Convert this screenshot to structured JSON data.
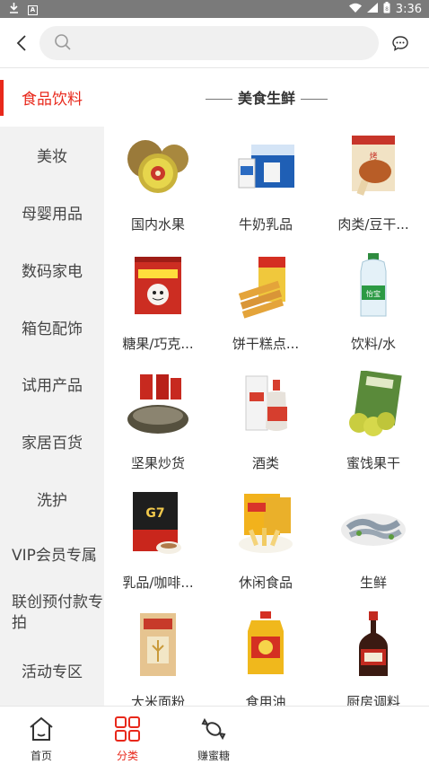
{
  "status_bar": {
    "time": "3:36"
  },
  "header": {
    "search_placeholder": ""
  },
  "sidebar": {
    "items": [
      {
        "label": "食品饮料",
        "active": true
      },
      {
        "label": "美妆"
      },
      {
        "label": "母婴用品"
      },
      {
        "label": "数码家电"
      },
      {
        "label": "箱包配饰"
      },
      {
        "label": "试用产品"
      },
      {
        "label": "家居百货"
      },
      {
        "label": "洗护"
      },
      {
        "label": "VIP会员专属"
      },
      {
        "label": "联创预付款专拍"
      },
      {
        "label": "活动专区"
      }
    ]
  },
  "section": {
    "title": "美食生鲜"
  },
  "categories": [
    {
      "label": "国内水果",
      "icon": "kiwi-fruit-icon"
    },
    {
      "label": "牛奶乳品",
      "icon": "milk-box-icon"
    },
    {
      "label": "肉类/豆干...",
      "icon": "meat-snack-icon"
    },
    {
      "label": "糖果/巧克...",
      "icon": "candy-bag-icon"
    },
    {
      "label": "饼干糕点...",
      "icon": "wafer-biscuit-icon"
    },
    {
      "label": "饮料/水",
      "icon": "water-bottle-icon"
    },
    {
      "label": "坚果炒货",
      "icon": "sunflower-seeds-icon"
    },
    {
      "label": "酒类",
      "icon": "liquor-bottle-icon"
    },
    {
      "label": "蜜饯果干",
      "icon": "dried-fruit-bag-icon"
    },
    {
      "label": "乳品/咖啡...",
      "icon": "coffee-pack-icon"
    },
    {
      "label": "休闲食品",
      "icon": "fries-snack-icon"
    },
    {
      "label": "生鲜",
      "icon": "shrimp-plate-icon"
    },
    {
      "label": "大米面粉",
      "icon": "rice-bag-icon"
    },
    {
      "label": "食用油",
      "icon": "oil-bottle-icon"
    },
    {
      "label": "厨房调料",
      "icon": "soy-sauce-icon"
    }
  ],
  "tabbar": {
    "items": [
      {
        "label": "首页",
        "icon": "home-icon"
      },
      {
        "label": "分类",
        "icon": "category-grid-icon",
        "active": true
      },
      {
        "label": "赚蜜糖",
        "icon": "candy-icon"
      }
    ]
  },
  "colors": {
    "accent": "#e8281b",
    "sidebar_bg": "#f2f2f2",
    "status_bar": "#7a7a7a"
  }
}
